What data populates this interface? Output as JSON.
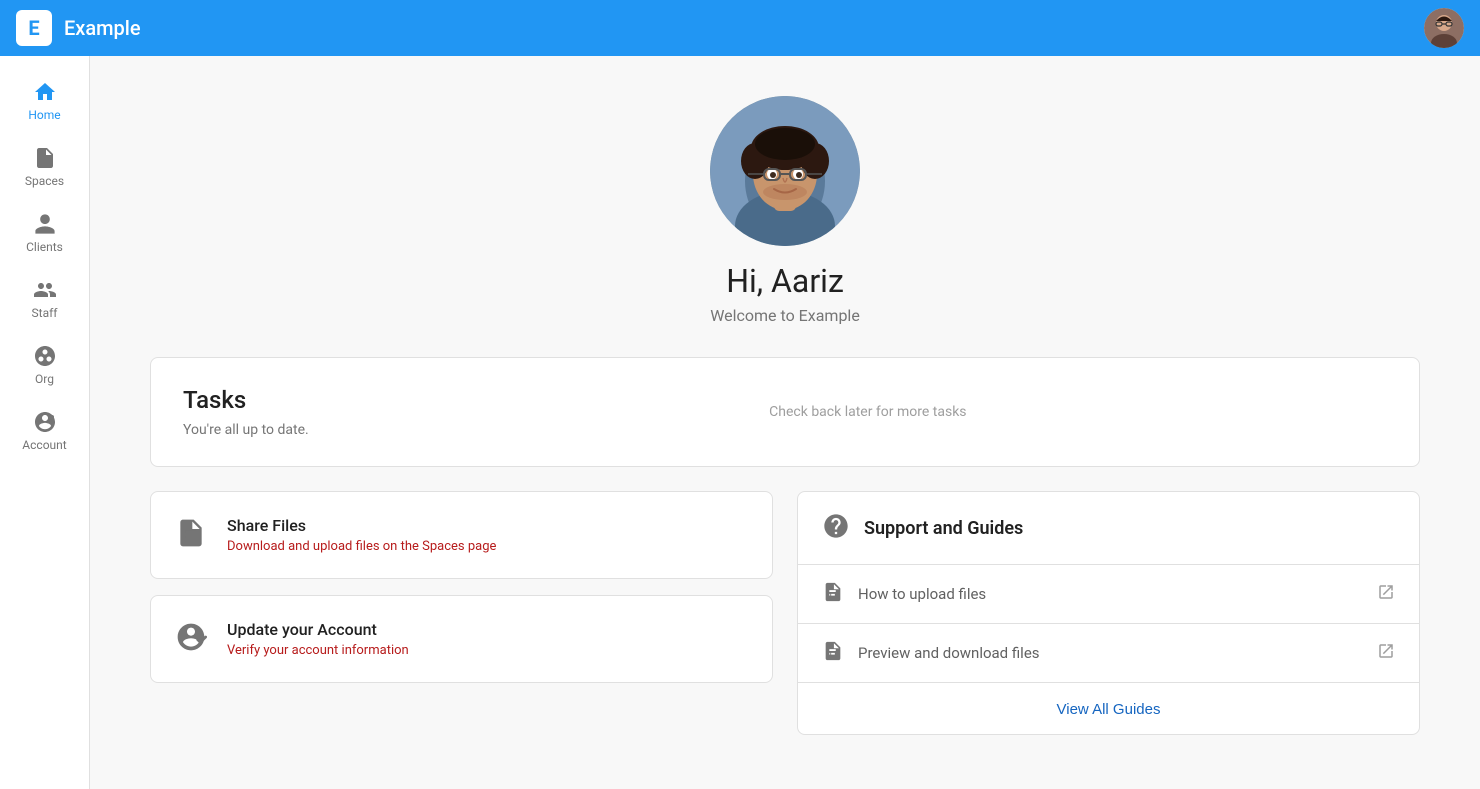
{
  "app": {
    "logo": "E",
    "title": "Example"
  },
  "user": {
    "name": "Aariz",
    "greeting": "Hi, Aariz",
    "welcome": "Welcome to Example"
  },
  "sidebar": {
    "items": [
      {
        "id": "home",
        "label": "Home",
        "active": true
      },
      {
        "id": "spaces",
        "label": "Spaces",
        "active": false
      },
      {
        "id": "clients",
        "label": "Clients",
        "active": false
      },
      {
        "id": "staff",
        "label": "Staff",
        "active": false
      },
      {
        "id": "org",
        "label": "Org",
        "active": false
      },
      {
        "id": "account",
        "label": "Account",
        "active": false
      }
    ]
  },
  "tasks": {
    "title": "Tasks",
    "up_to_date": "You're all up to date.",
    "empty_message": "Check back later for more tasks"
  },
  "action_cards": [
    {
      "id": "share-files",
      "title": "Share Files",
      "subtitle": "Download and upload files on the Spaces page",
      "subtitle_color": "red"
    },
    {
      "id": "update-account",
      "title": "Update your Account",
      "subtitle": "Verify your account information",
      "subtitle_color": "red"
    }
  ],
  "support": {
    "title": "Support and Guides",
    "links": [
      {
        "id": "upload",
        "text": "How to upload files"
      },
      {
        "id": "preview",
        "text": "Preview and download files"
      }
    ],
    "view_all": "View All Guides"
  }
}
